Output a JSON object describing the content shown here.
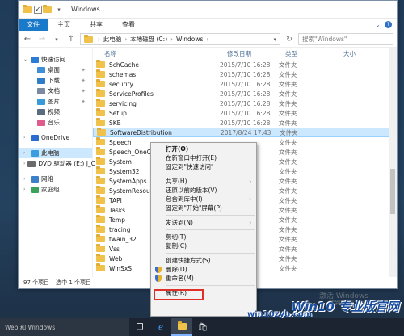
{
  "window": {
    "title": "Windows",
    "qat_check": "✓"
  },
  "ribbon": {
    "tabs": [
      "文件",
      "主页",
      "共享",
      "查看"
    ]
  },
  "address": {
    "crumbs": [
      "此电脑",
      "本地磁盘 (C:)",
      "Windows"
    ],
    "search_placeholder": "搜索\"Windows\""
  },
  "nav_pane": {
    "items": [
      {
        "label": "快速访问",
        "color": "#2b7cd3"
      },
      {
        "label": "桌面",
        "color": "#3f8ed8",
        "pinned": true
      },
      {
        "label": "下载",
        "color": "#2f7dc8",
        "pinned": true
      },
      {
        "label": "文档",
        "color": "#7a8aa0",
        "pinned": true
      },
      {
        "label": "图片",
        "color": "#3a9ad9",
        "pinned": true
      },
      {
        "label": "视频",
        "color": "#5a6b80"
      },
      {
        "label": "音乐",
        "color": "#e05a8b"
      },
      {
        "label": "OneDrive",
        "color": "#2a6fd0"
      },
      {
        "label": "此电脑",
        "color": "#3c9ce0",
        "selected": true
      },
      {
        "label": "DVD 驱动器 (E:) J_C",
        "color": "#6b6b6b"
      },
      {
        "label": "网络",
        "color": "#3e80c8"
      },
      {
        "label": "家庭组",
        "color": "#3aa25a"
      }
    ]
  },
  "columns": {
    "name": "名称",
    "date": "修改日期",
    "type": "类型",
    "size": "大小"
  },
  "files": [
    {
      "name": "SchCache",
      "date": "2015/7/10 16:28",
      "type": "文件夹"
    },
    {
      "name": "schemas",
      "date": "2015/7/10 16:28",
      "type": "文件夹"
    },
    {
      "name": "security",
      "date": "2015/7/10 16:28",
      "type": "文件夹"
    },
    {
      "name": "ServiceProfiles",
      "date": "2015/7/10 16:28",
      "type": "文件夹"
    },
    {
      "name": "servicing",
      "date": "2015/7/10 16:28",
      "type": "文件夹"
    },
    {
      "name": "Setup",
      "date": "2015/7/10 16:28",
      "type": "文件夹"
    },
    {
      "name": "SKB",
      "date": "2015/7/10 16:28",
      "type": "文件夹"
    },
    {
      "name": "SoftwareDistribution",
      "date": "2017/8/24 17:43",
      "type": "文件夹",
      "selected": true
    },
    {
      "name": "Speech",
      "date": "",
      "type": "文件夹"
    },
    {
      "name": "Speech_OneCo",
      "date": "",
      "type": "文件夹"
    },
    {
      "name": "System",
      "date": "",
      "type": "文件夹"
    },
    {
      "name": "System32",
      "date": "",
      "type": "文件夹"
    },
    {
      "name": "SystemApps",
      "date": "",
      "type": "文件夹"
    },
    {
      "name": "SystemResour",
      "date": "",
      "type": "文件夹"
    },
    {
      "name": "TAPI",
      "date": "",
      "type": "文件夹"
    },
    {
      "name": "Tasks",
      "date": "",
      "type": "文件夹"
    },
    {
      "name": "Temp",
      "date": "",
      "type": "文件夹"
    },
    {
      "name": "tracing",
      "date": "",
      "type": "文件夹"
    },
    {
      "name": "twain_32",
      "date": "",
      "type": "文件夹"
    },
    {
      "name": "Vss",
      "date": "",
      "type": "文件夹"
    },
    {
      "name": "Web",
      "date": "",
      "type": "文件夹"
    },
    {
      "name": "WinSxS",
      "date": "",
      "type": "文件夹"
    }
  ],
  "status": {
    "count": "97 个项目",
    "selection": "选中 1 个项目"
  },
  "context_menu": [
    {
      "label": "打开(O)"
    },
    {
      "label": "在新窗口中打开(E)"
    },
    {
      "label": "固定到\"快速访问\""
    },
    {
      "sep": true
    },
    {
      "label": "共享(H)",
      "submenu": true
    },
    {
      "label": "还原以前的版本(V)"
    },
    {
      "label": "包含到库中(I)",
      "submenu": true
    },
    {
      "label": "固定到\"开始\"屏幕(P)"
    },
    {
      "sep": true
    },
    {
      "label": "发送到(N)",
      "submenu": true
    },
    {
      "sep": true
    },
    {
      "label": "剪切(T)"
    },
    {
      "label": "复制(C)"
    },
    {
      "sep": true
    },
    {
      "label": "创建快捷方式(S)"
    },
    {
      "label": "删除(D)",
      "shield": true
    },
    {
      "label": "重命名(M)",
      "shield": true
    },
    {
      "sep": true
    },
    {
      "label": "属性(R)"
    }
  ],
  "taskbar": {
    "search_text": "Web 和 Windows"
  },
  "overlay": {
    "activate_title": "激活 Windows",
    "activate_sub": "转到\"设置\"以激活 Windows",
    "watermark": "Win10 专业版官网",
    "site": "win10zyb.com"
  }
}
